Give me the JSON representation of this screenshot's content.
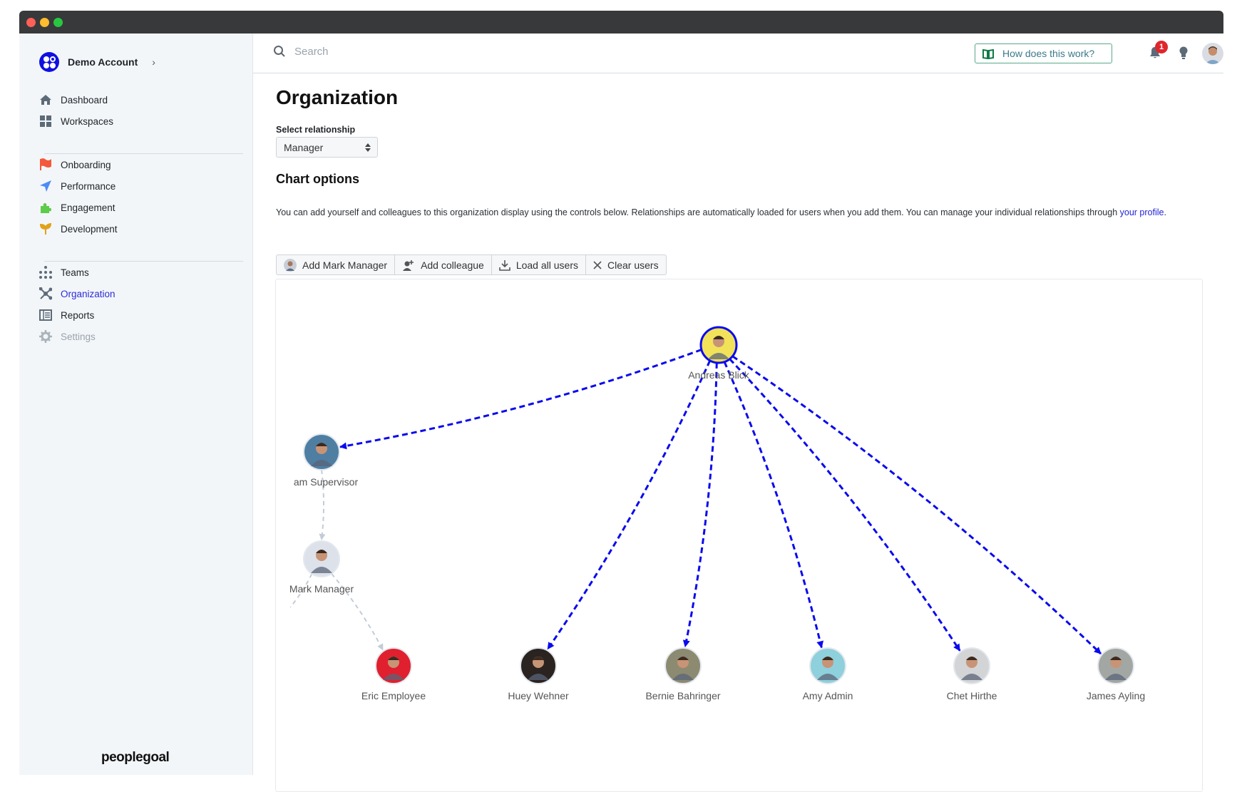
{
  "window": {
    "controls": [
      "close",
      "minimize",
      "maximize"
    ],
    "control_colors": [
      "#fe5f57",
      "#febc2e",
      "#28c840"
    ]
  },
  "sidebar": {
    "account": {
      "label": "Demo Account",
      "icon": "chevron-right-icon"
    },
    "groups": [
      [
        {
          "label": "Dashboard",
          "icon": "home-icon"
        },
        {
          "label": "Workspaces",
          "icon": "grid-icon"
        }
      ],
      [
        {
          "label": "Onboarding",
          "icon": "flag-icon",
          "color": "#f3593a"
        },
        {
          "label": "Performance",
          "icon": "paper-plane-icon",
          "color": "#4d8cf5"
        },
        {
          "label": "Engagement",
          "icon": "puzzle-icon",
          "color": "#5ccc4b"
        },
        {
          "label": "Development",
          "icon": "sprout-icon",
          "color": "#e1a11a"
        }
      ],
      [
        {
          "label": "Teams",
          "icon": "hierarchy-icon"
        },
        {
          "label": "Organization",
          "icon": "network-icon",
          "active": true
        },
        {
          "label": "Reports",
          "icon": "table-icon"
        },
        {
          "label": "Settings",
          "icon": "gear-icon",
          "disabled": true
        }
      ]
    ],
    "brand": "peoplegoal"
  },
  "header": {
    "search_placeholder": "Search",
    "help_label": "How does this work?",
    "notification_count": "1"
  },
  "main": {
    "title": "Organization",
    "relationship_label": "Select relationship",
    "relationship_value": "Manager",
    "chart_options_title": "Chart options",
    "description": "You can add yourself and colleagues to this organization display using the controls below. Relationships are automatically loaded for users when you add them. You can manage your individual relationships through ",
    "profile_link": "your profile",
    "description_end": ".",
    "buttons": [
      {
        "label": "Add Mark Manager",
        "icon": "avatar-icon"
      },
      {
        "label": "Add colleague",
        "icon": "add-user-icon"
      },
      {
        "label": "Load all users",
        "icon": "download-icon"
      },
      {
        "label": "Clear users",
        "icon": "close-icon"
      }
    ]
  },
  "org_chart": {
    "accent_color": "#0a0aee",
    "muted_edge_color": "#c3ccd6",
    "nodes": [
      {
        "id": "andreas",
        "label": "Andreas Blick",
        "selected": true,
        "bg": "#f1e25a"
      },
      {
        "id": "supervisor",
        "label": "am Supervisor",
        "bg": "#4f7ea3"
      },
      {
        "id": "mark",
        "label": "Mark Manager",
        "bg": "#dde2ea"
      },
      {
        "id": "eric",
        "label": "Eric Employee",
        "bg": "#e0202f"
      },
      {
        "id": "huey",
        "label": "Huey Wehner",
        "bg": "#2b2320"
      },
      {
        "id": "bernie",
        "label": "Bernie Bahringer",
        "bg": "#8d8a72"
      },
      {
        "id": "amy",
        "label": "Amy Admin",
        "bg": "#8ed0db"
      },
      {
        "id": "chet",
        "label": "Chet Hirthe",
        "bg": "#d3d4d6"
      },
      {
        "id": "james",
        "label": "James Ayling",
        "bg": "#a3a7a4"
      }
    ],
    "edges": [
      {
        "from": "andreas",
        "to": "supervisor",
        "highlight": true
      },
      {
        "from": "andreas",
        "to": "huey",
        "highlight": true
      },
      {
        "from": "andreas",
        "to": "bernie",
        "highlight": true
      },
      {
        "from": "andreas",
        "to": "amy",
        "highlight": true
      },
      {
        "from": "andreas",
        "to": "chet",
        "highlight": true
      },
      {
        "from": "andreas",
        "to": "james",
        "highlight": true
      },
      {
        "from": "supervisor",
        "to": "mark",
        "highlight": false
      },
      {
        "from": "mark",
        "to": "eric",
        "highlight": false
      },
      {
        "from": "mark",
        "to": "offscreen",
        "highlight": false
      }
    ]
  }
}
